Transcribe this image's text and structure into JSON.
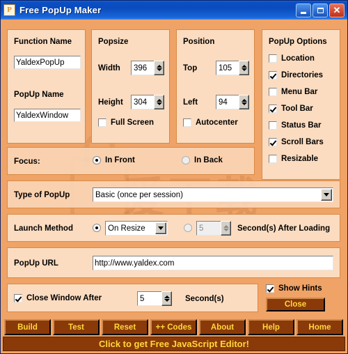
{
  "window": {
    "title": "Free PopUp Maker",
    "icon": "app-p-icon",
    "controls": {
      "minimize": "minimize",
      "maximize": "maximize",
      "close": "close"
    },
    "titlebar_color": "#0a4bbd"
  },
  "theme": {
    "client_bg": "#f0a367",
    "panel_bg": "#fbdcc0",
    "panel_border": "#d78a45",
    "button_bg": "#8a3a09",
    "button_text": "#ffd83a"
  },
  "watermark": {
    "cjk": "爱下载",
    "url": "anxz.com"
  },
  "function_panel": {
    "title": "Function Name",
    "function_name_value": "YaldexPopUp",
    "popup_name_label": "PopUp Name",
    "popup_name_value": "YaldexWindow"
  },
  "popsize_panel": {
    "title": "Popsize",
    "width_label": "Width",
    "width_value": "396",
    "height_label": "Height",
    "height_value": "304",
    "fullscreen_label": "Full Screen",
    "fullscreen_checked": false
  },
  "position_panel": {
    "title": "Position",
    "top_label": "Top",
    "top_value": "105",
    "left_label": "Left",
    "left_value": "94",
    "autocenter_label": "Autocenter",
    "autocenter_checked": false
  },
  "options_panel": {
    "title": "PopUp Options",
    "items": [
      {
        "label": "Location",
        "mnemonic": "L",
        "checked": false
      },
      {
        "label": "Directories",
        "mnemonic": "i",
        "checked": true
      },
      {
        "label": "Menu Bar",
        "mnemonic": "M",
        "checked": false
      },
      {
        "label": "Tool Bar",
        "mnemonic": "l",
        "checked": true
      },
      {
        "label": "Status Bar",
        "mnemonic": "B",
        "checked": false
      },
      {
        "label": "Scroll Bars",
        "mnemonic": "c",
        "checked": true
      },
      {
        "label": "Resizable",
        "mnemonic": "R",
        "checked": false
      }
    ]
  },
  "focus_row": {
    "label": "Focus:",
    "in_front_label": "In Front",
    "in_back_label": "In Back",
    "selected": "In Front"
  },
  "type_row": {
    "label": "Type of PopUp",
    "value": "Basic (once per session)"
  },
  "launch_row": {
    "label": "Launch Method",
    "method_value": "On Resize",
    "method_selected": true,
    "delay_value": "5",
    "delay_selected": false,
    "delay_suffix": "Second(s) After Loading"
  },
  "url_row": {
    "label": "PopUp URL",
    "value": "http://www.yaldex.com"
  },
  "close_row": {
    "label": "Close Window After",
    "checked": true,
    "seconds_value": "5",
    "seconds_suffix": "Second(s)",
    "show_hints_label": "Show Hints",
    "show_hints_checked": true,
    "close_button_label": "Close"
  },
  "toolbar": {
    "buttons": [
      {
        "label": "Build"
      },
      {
        "label": "Test"
      },
      {
        "label": "Reset"
      },
      {
        "label": "++ Codes"
      },
      {
        "label": "About"
      },
      {
        "label": "Help"
      },
      {
        "label": "Home"
      }
    ],
    "promo": "Click to get  Free JavaScript Editor!"
  }
}
